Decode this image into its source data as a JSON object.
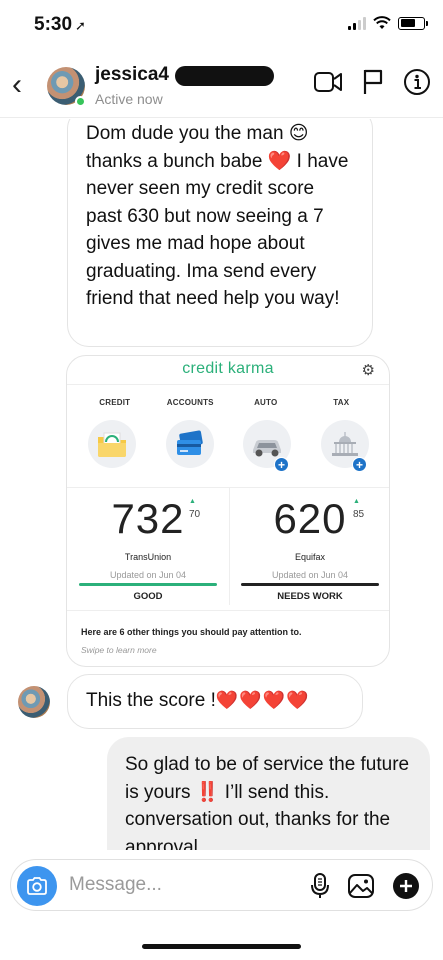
{
  "status_bar": {
    "time": "5:30",
    "location_arrow": "➚"
  },
  "header": {
    "contact_name": "jessica4",
    "status": "Active now",
    "icons": [
      "back-icon",
      "video-call-icon",
      "report-flag-icon",
      "info-icon"
    ]
  },
  "messages": {
    "m1": {
      "text": "Dom dude you the man 😊 thanks a bunch babe ❤️ I have never seen my credit score past 630 but now seeing a 7 gives me mad hope about graduating. Ima send every friend that need help you way!"
    },
    "m2": {
      "text": "This the score !",
      "hearts": "❤️❤️❤️❤️"
    },
    "m3": {
      "text_before": "So glad to be of service the future is yours",
      "bang": "‼️",
      "text_after": " I’ll send this. conversation out, thanks for the approval"
    }
  },
  "credit_karma": {
    "brand": "credit karma",
    "tabs": [
      "CREDIT",
      "ACCOUNTS",
      "AUTO",
      "TAX"
    ],
    "scores": [
      {
        "value": "732",
        "delta": "70",
        "bureau": "TransUnion",
        "updated": "Updated on Jun 04",
        "rating": "GOOD",
        "bar_color": "#2bb07a"
      },
      {
        "value": "620",
        "delta": "85",
        "bureau": "Equifax",
        "updated": "Updated on Jun 04",
        "rating": "NEEDS WORK",
        "bar_color": "#222222"
      }
    ],
    "note": "Here are 6 other things you should pay attention to.",
    "swipe": "Swipe to learn more",
    "accent_color": "#2bb07a"
  },
  "composer": {
    "placeholder": "Message..."
  },
  "colors": {
    "camera_button": "#3d95ef",
    "heart": "#e0242b",
    "online": "#37c45a"
  }
}
